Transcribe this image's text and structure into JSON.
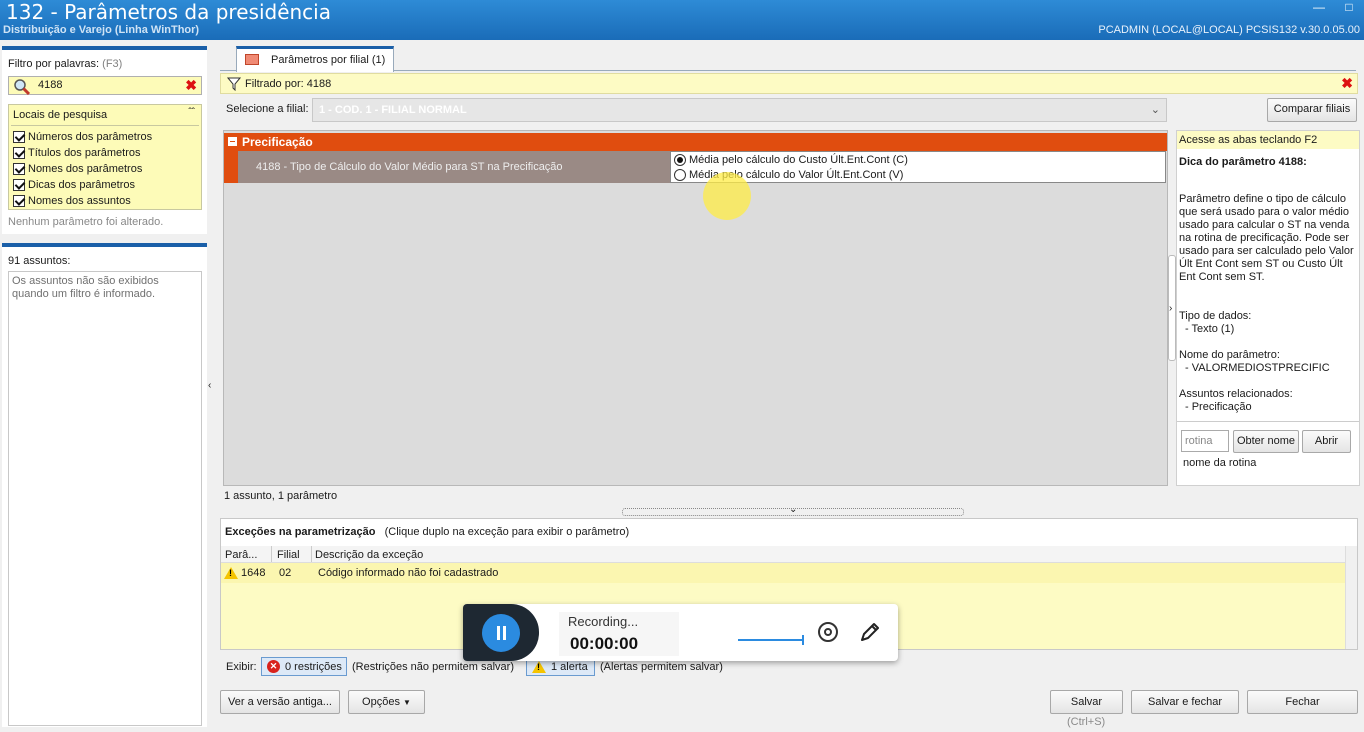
{
  "window": {
    "title": "132 - Parâmetros da presidência",
    "subtitle": "Distribuição e Varejo (Linha WinThor)",
    "userinfo": "PCADMIN (LOCAL@LOCAL)   PCSIS132  v.30.0.05.00"
  },
  "filter": {
    "label": "Filtro por palavras:",
    "shortcut": "(F3)",
    "value": "4188"
  },
  "locais": {
    "title": "Locais de pesquisa",
    "items": [
      "Números dos parâmetros",
      "Títulos dos parâmetros",
      "Nomes dos parâmetros",
      "Dicas dos parâmetros",
      "Nomes dos assuntos"
    ],
    "none_changed": "Nenhum parâmetro foi alterado."
  },
  "assuntos": {
    "label": "91 assuntos:",
    "note": "Os assuntos não são exibidos quando um filtro é informado."
  },
  "tab": {
    "label": "Parâmetros por filial",
    "count": "(1)"
  },
  "filtrado": {
    "text": "Filtrado por: 4188"
  },
  "filial": {
    "label": "Selecione a filial:",
    "value": "1 - COD. 1 - FILIAL NORMAL",
    "compare_button": "Comparar filiais"
  },
  "grid": {
    "group": "Precificação",
    "param_title": "4188 - Tipo de Cálculo do Valor Médio para ST na Precificação",
    "options": [
      {
        "label": "Média pelo cálculo do Custo Últ.Ent.Cont (C)",
        "selected": true
      },
      {
        "label": "Média pelo cálculo do Valor Últ.Ent.Cont (V)",
        "selected": false
      }
    ],
    "summary": "1 assunto, 1 parâmetro"
  },
  "help": {
    "access": "Acesse as abas teclando F2",
    "title": "Dica do parâmetro 4188:",
    "description": "Parâmetro define o tipo de cálculo que será usado para o valor médio usado para calcular o ST na venda na rotina de precificação. Pode ser usado para ser calculado pelo Valor Últ Ent Cont sem ST ou Custo Últ Ent Cont sem ST.",
    "tipo_label": "Tipo de dados:",
    "tipo_value": "- Texto (1)",
    "nome_label": "Nome do parâmetro:",
    "nome_value": "- VALORMEDIOSTPRECIFIC",
    "assuntos_label": "Assuntos relacionados:",
    "assuntos_value": "- Precificação",
    "rotina_placeholder": "rotina",
    "obter_button": "Obter nome",
    "abrir_button": "Abrir",
    "rotina_name": "nome da rotina"
  },
  "excecoes": {
    "title": "Exceções na parametrização",
    "hint": "(Clique duplo na exceção para exibir o parâmetro)",
    "columns": [
      "Parâ...",
      "Filial",
      "Descrição da exceção"
    ],
    "rows": [
      {
        "param": "1648",
        "filial": "02",
        "desc": "Código informado não foi cadastrado"
      }
    ]
  },
  "exibir": {
    "label": "Exibir:",
    "restricoes": "0 restrições",
    "restricoes_note": "(Restrições não permitem salvar)",
    "alertas": "1 alerta",
    "alertas_note": "(Alertas permitem salvar)"
  },
  "recording": {
    "status": "Recording...",
    "time": "00:00:00"
  },
  "footer": {
    "versao": "Ver a versão antiga...",
    "opcoes": "Opções",
    "salvar": "Salvar",
    "salvar_shortcut": "(Ctrl+S)",
    "salvar_fechar": "Salvar e fechar",
    "fechar": "Fechar"
  }
}
